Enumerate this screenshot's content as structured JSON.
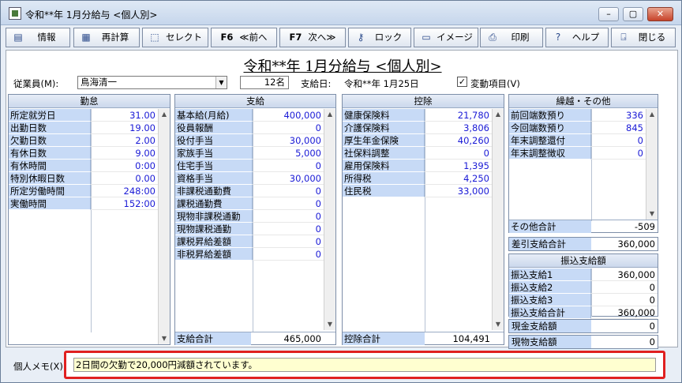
{
  "window": {
    "title": "令和**年 1月分給与 <個人別>",
    "controls": {
      "minimize": "–",
      "maximize": "▢",
      "close": "✕"
    }
  },
  "toolbar": {
    "info": "情報",
    "recalc": "再計算",
    "select": "セレクト",
    "prev_key": "F6",
    "prev": "≪前へ",
    "next_key": "F7",
    "next": "次へ≫",
    "lock": "ロック",
    "image": "イメージ",
    "print": "印刷",
    "help": "ヘルプ",
    "close": "閉じる"
  },
  "page_title": "令和**年 1月分給与 <個人別>",
  "header": {
    "employee_label": "従業員(M):",
    "employee_value": "鳥海清一",
    "count": "12名",
    "pay_date_label": "支給日:",
    "pay_date": "令和**年 1月25日",
    "variable_checked": "✓",
    "variable_label": "変動項目(V)"
  },
  "attendance": {
    "title": "勤怠",
    "rows": [
      {
        "label": "所定就労日",
        "value": "31.00"
      },
      {
        "label": "出勤日数",
        "value": "19.00"
      },
      {
        "label": "欠勤日数",
        "value": "2.00"
      },
      {
        "label": "有休日数",
        "value": "9.00"
      },
      {
        "label": "有休時間",
        "value": "0:00"
      },
      {
        "label": "特別休暇日数",
        "value": "0.00"
      },
      {
        "label": "所定労働時間",
        "value": "248:00"
      },
      {
        "label": "実働時間",
        "value": "152:00"
      }
    ]
  },
  "payment": {
    "title": "支給",
    "rows": [
      {
        "label": "基本給(月給)",
        "value": "400,000"
      },
      {
        "label": "役員報酬",
        "value": "0"
      },
      {
        "label": "役付手当",
        "value": "30,000"
      },
      {
        "label": "家族手当",
        "value": "5,000"
      },
      {
        "label": "住宅手当",
        "value": "0"
      },
      {
        "label": "資格手当",
        "value": "30,000"
      },
      {
        "label": "非課税通勤費",
        "value": "0"
      },
      {
        "label": "課税通勤費",
        "value": "0"
      },
      {
        "label": "現物非課税通勤",
        "value": "0"
      },
      {
        "label": "現物課税通勤",
        "value": "0"
      },
      {
        "label": "課税昇給差額",
        "value": "0"
      },
      {
        "label": "非税昇給差額",
        "value": "0"
      }
    ],
    "total_label": "支給合計",
    "total": "465,000"
  },
  "deduction": {
    "title": "控除",
    "rows": [
      {
        "label": "健康保険料",
        "value": "21,780"
      },
      {
        "label": "介護保険料",
        "value": "3,806"
      },
      {
        "label": "厚生年金保険",
        "value": "40,260"
      },
      {
        "label": "社保料調整",
        "value": "0"
      },
      {
        "label": "雇用保険料",
        "value": "1,395"
      },
      {
        "label": "所得税",
        "value": "4,250"
      },
      {
        "label": "住民税",
        "value": "33,000"
      }
    ],
    "total_label": "控除合計",
    "total": "104,491"
  },
  "carryover": {
    "title": "繰越・その他",
    "rows": [
      {
        "label": "前回端数預り",
        "value": "336"
      },
      {
        "label": "今回端数預り",
        "value": "845"
      },
      {
        "label": "年末調整還付",
        "value": "0"
      },
      {
        "label": "年末調整徴収",
        "value": "0"
      }
    ],
    "other_total_label": "その他合計",
    "other_total": "-509"
  },
  "net_pay": {
    "label": "差引支給合計",
    "value": "360,000"
  },
  "transfer": {
    "title": "振込支給額",
    "rows": [
      {
        "label": "振込支給1",
        "value": "360,000"
      },
      {
        "label": "振込支給2",
        "value": "0"
      },
      {
        "label": "振込支給3",
        "value": "0"
      }
    ],
    "total_label": "振込支給合計",
    "total": "360,000"
  },
  "cash_pay": {
    "label": "現金支給額",
    "value": "0"
  },
  "goods_pay": {
    "label": "現物支給額",
    "value": "0"
  },
  "memo": {
    "label": "個人メモ(X):",
    "value": "2日間の欠勤で20,000円減額されています。"
  }
}
